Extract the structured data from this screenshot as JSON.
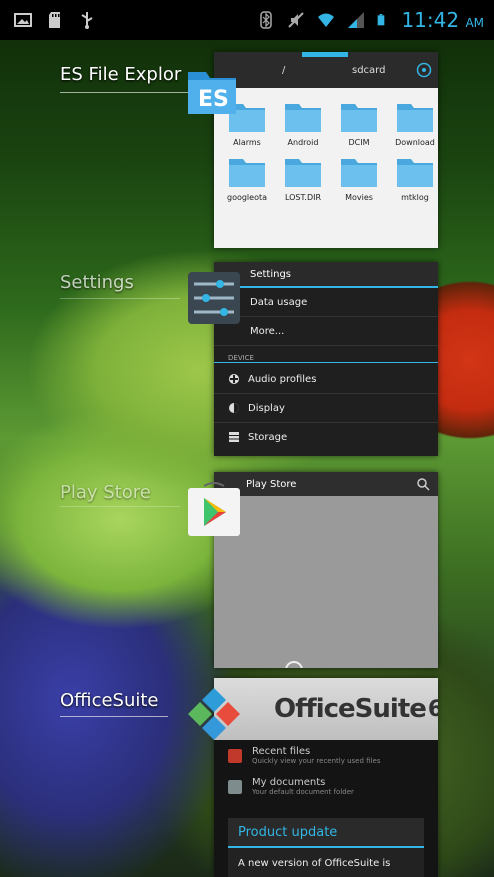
{
  "status_bar": {
    "time": "11:42",
    "ampm": "AM",
    "left_icons": [
      "gallery-icon",
      "sd-card-icon",
      "usb-icon"
    ],
    "right_icons": [
      "bluetooth-icon",
      "muted-icon",
      "wifi-icon",
      "signal-icon",
      "battery-icon"
    ],
    "accent": "#33b5e5"
  },
  "recent_apps": [
    {
      "label": "ES File Explor",
      "folders": [
        "Alarms",
        "Android",
        "DCIM",
        "Download",
        "googleota",
        "LOST.DIR",
        "Movies",
        "mtklog"
      ],
      "tabs": [
        "/",
        "sdcard"
      ]
    },
    {
      "label": "Settings",
      "title": "Settings",
      "items": [
        "Data usage",
        "More..."
      ],
      "section": "DEVICE",
      "device_items": [
        "Audio profiles",
        "Display",
        "Storage"
      ]
    },
    {
      "label": "Play Store",
      "title": "Play Store"
    },
    {
      "label": "OfficeSuite",
      "banner": "OfficeSuite",
      "banner_version": "6",
      "items": [
        {
          "title": "Recent files",
          "sub": "Quickly view your recently used files"
        },
        {
          "title": "My documents",
          "sub": "Your default document folder"
        }
      ],
      "dialog_title": "Product update",
      "dialog_text": "A new version of OfficeSuite is"
    }
  ]
}
